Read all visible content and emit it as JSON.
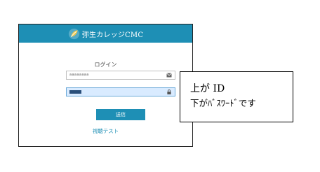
{
  "header": {
    "brand_name": "弥生カレッジCMC",
    "logo_icon": "leaf-logo-icon",
    "bar_color": "#1e8fb5"
  },
  "login": {
    "title": "ログイン",
    "id_value": "aaaaaaaa",
    "id_icon": "envelope-icon",
    "password_icon": "lock-icon",
    "submit_label": "送信",
    "link_text": "視聴テスト"
  },
  "annotation": {
    "line1": "上が ID",
    "line2": "下がﾊﾞｽﾜｰﾄﾞです"
  }
}
